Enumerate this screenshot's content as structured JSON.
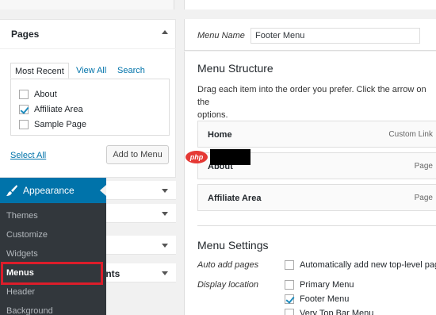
{
  "pages_box": {
    "title": "Pages",
    "tabs": [
      "Most Recent",
      "View All",
      "Search"
    ],
    "items": [
      {
        "label": "About",
        "checked": false
      },
      {
        "label": "Affiliate Area",
        "checked": true
      },
      {
        "label": "Sample Page",
        "checked": false
      }
    ],
    "select_all": "Select All",
    "add_button": "Add to Menu"
  },
  "accordion": {
    "partial_label": "ints"
  },
  "admin_menu": {
    "appearance": "Appearance",
    "items": [
      "Themes",
      "Customize",
      "Widgets",
      "Menus",
      "Header",
      "Background"
    ],
    "current": "Menus"
  },
  "menu_name": {
    "label": "Menu Name",
    "value": "Footer Menu"
  },
  "structure": {
    "title": "Menu Structure",
    "instructions": "Drag each item into the order you prefer. Click the arrow on the",
    "instructions_cont": "options.",
    "items": [
      {
        "title": "Home",
        "kind": "Custom Link"
      },
      {
        "title": "About",
        "kind": "Page"
      },
      {
        "title": "Affiliate Area",
        "kind": "Page"
      }
    ]
  },
  "settings": {
    "title": "Menu Settings",
    "auto_add_label": "Auto add pages",
    "auto_add_text": "Automatically add new top-level pag",
    "display_label": "Display location",
    "locations": [
      {
        "label": "Primary Menu",
        "checked": false
      },
      {
        "label": "Footer Menu",
        "checked": true
      },
      {
        "label": "Very Top Bar Menu",
        "checked": false
      }
    ]
  },
  "watermark": {
    "text": "php"
  },
  "colors": {
    "accent": "#0073aa",
    "admin_bg": "#32373c",
    "highlight": "#dc1d2a"
  }
}
